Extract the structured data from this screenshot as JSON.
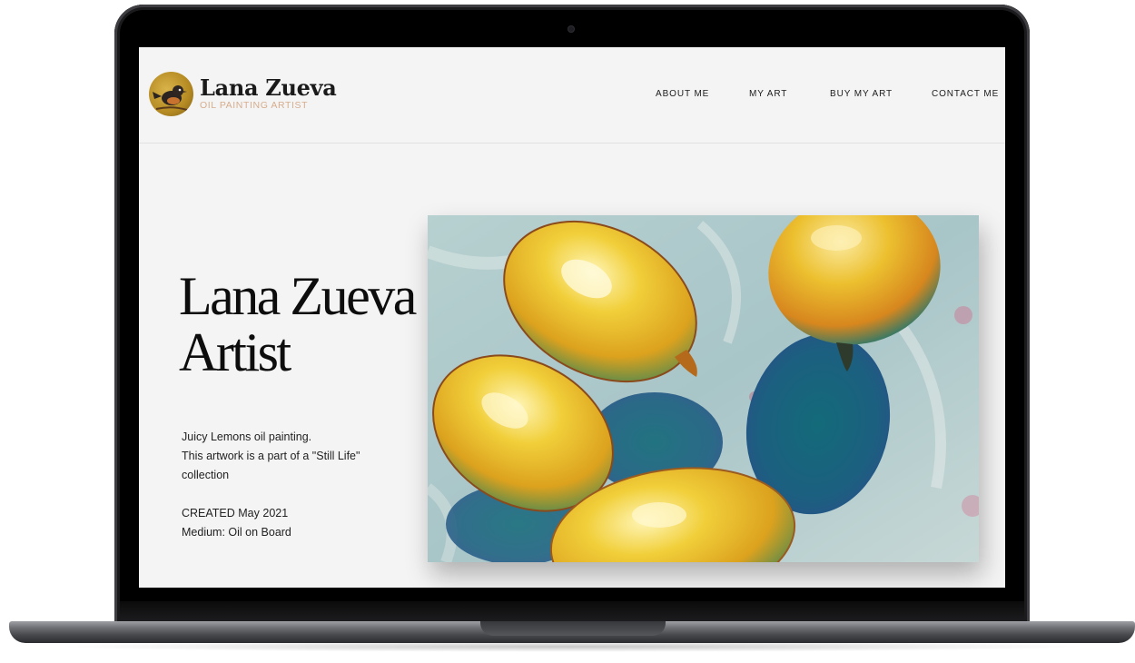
{
  "header": {
    "logo": {
      "name": "Lana Zueva",
      "tagline": "OIL PAINTING ARTIST",
      "avatar_icon": "bird-painting-icon"
    },
    "nav": [
      {
        "label": "ABOUT ME"
      },
      {
        "label": "MY ART"
      },
      {
        "label": "BUY MY ART"
      },
      {
        "label": "CONTACT ME"
      }
    ]
  },
  "hero": {
    "title_line1": "Lana Zueva",
    "title_line2": "Artist",
    "description": [
      "Juicy Lemons oil painting.",
      "This artwork is a part of a \"Still Life\" collection"
    ],
    "created": "CREATED May 2021",
    "medium": "Medium: Oil on Board"
  },
  "artwork": {
    "subject": "lemons-oil-painting",
    "colors": {
      "background": "#a9c6c8",
      "lemon": "#e9c02a",
      "lemon_shadow": "#1f6b78",
      "highlight": "#fbf0a8"
    }
  },
  "colors": {
    "screen_background": "#f4f4f4",
    "tagline": "#d6ad8d",
    "text": "#1c1c1c"
  }
}
